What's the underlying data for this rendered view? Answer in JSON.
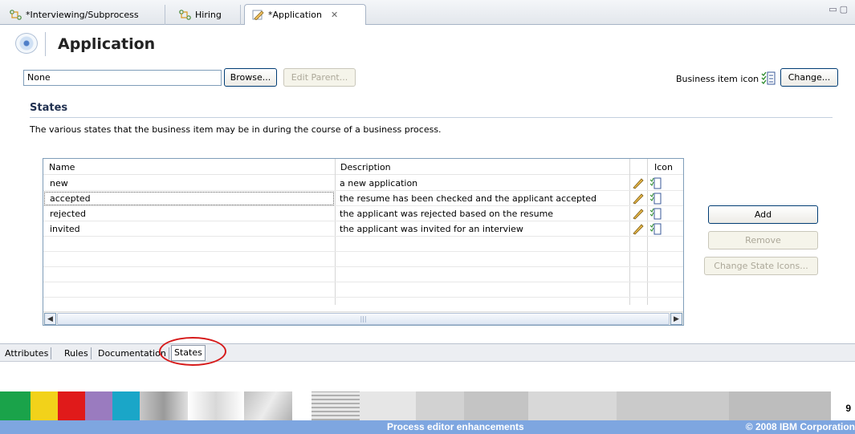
{
  "tabs": [
    {
      "label": "*Interviewing/Subprocess",
      "icon": "process-icon"
    },
    {
      "label": "Hiring",
      "icon": "process-icon"
    },
    {
      "label": "*Application",
      "icon": "business-item-icon",
      "active": true
    }
  ],
  "header": {
    "title": "Application"
  },
  "parent": {
    "value": "None",
    "browse_label": "Browse...",
    "edit_parent_label": "Edit Parent..."
  },
  "business_icon": {
    "label": "Business item icon",
    "change_label": "Change..."
  },
  "states": {
    "title": "States",
    "description": "The various states that the business item may be in during the course of a business process.",
    "columns": [
      "Name",
      "Description",
      "Icon"
    ],
    "rows": [
      {
        "name": "new",
        "description": "a new application"
      },
      {
        "name": "accepted",
        "description": "the resume has been checked and the applicant accepted"
      },
      {
        "name": "rejected",
        "description": "the applicant was rejected based on the resume"
      },
      {
        "name": "invited",
        "description": "the applicant was invited for an interview"
      }
    ],
    "add_label": "Add",
    "remove_label": "Remove",
    "change_icons_label": "Change State Icons..."
  },
  "page_tabs": [
    "Attributes",
    "Rules",
    "Documentation",
    "States"
  ],
  "footer": {
    "left": "Process editor enhancements",
    "right": "© 2008 IBM Corporation",
    "page": "9"
  },
  "colors": {
    "accent": "#7ea6e0",
    "highlight_ellipse": "#d61a1a"
  }
}
